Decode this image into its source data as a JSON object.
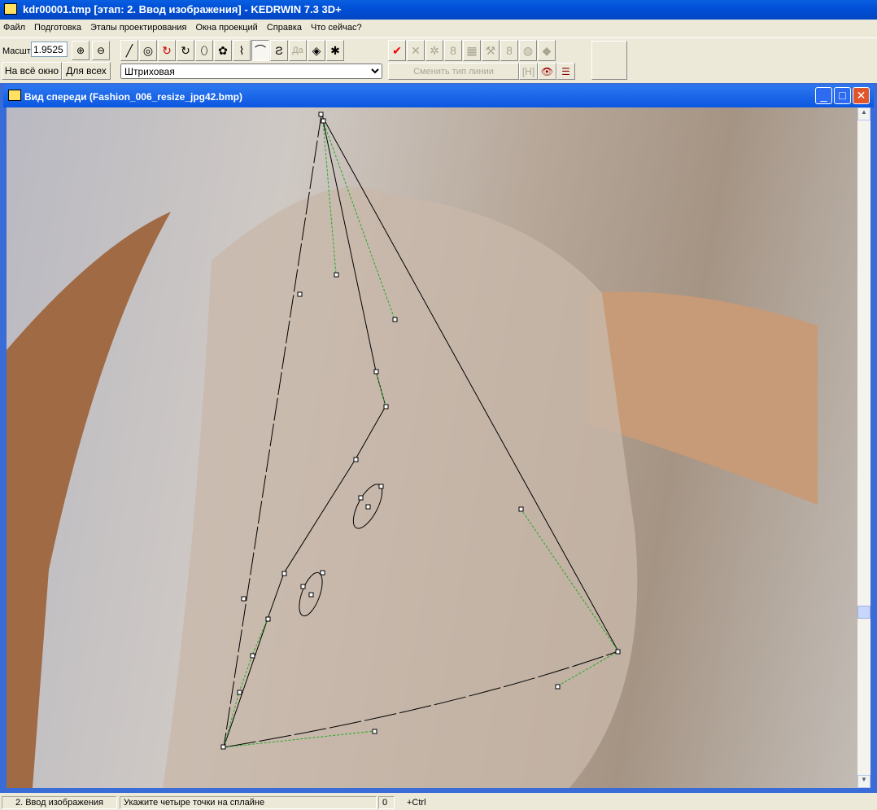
{
  "title": "kdr00001.tmp [этап: 2. Ввод изображения] - KEDRWIN 7.3 3D+",
  "menu": [
    "Файл",
    "Подготовка",
    "Этапы проектирования",
    "Окна проекций",
    "Справка",
    "Что сейчас?"
  ],
  "toolbar": {
    "scale_label": "Масшт",
    "scale_value": "1.9525",
    "fit_window": "На всё окно",
    "for_all": "Для всех",
    "line_type": "Штриховая",
    "change_line_type": "Сменить тип линии",
    "disabled_da": "Да"
  },
  "child_window": {
    "title": "Вид спереди (Fashion_006_resize_jpg42.bmp)"
  },
  "status": {
    "stage": "2. Ввод изображения",
    "hint": "Укажите четыре точки на сплайне",
    "count": "0",
    "modifier": "+Ctrl"
  }
}
